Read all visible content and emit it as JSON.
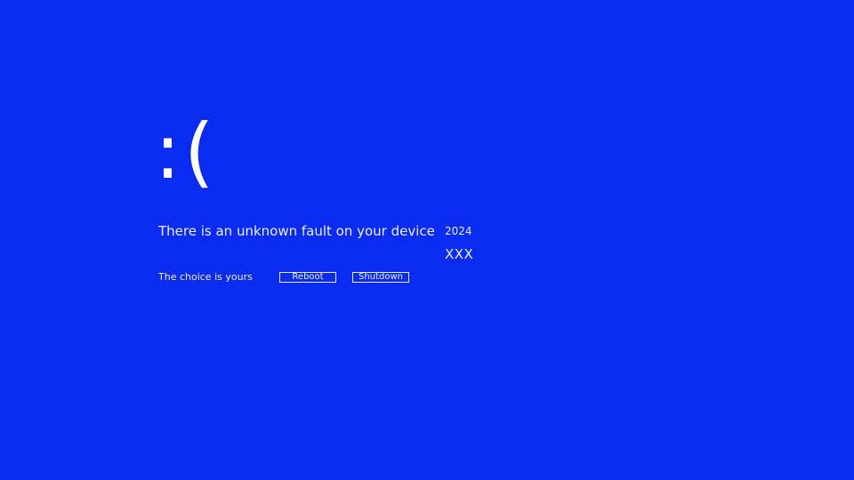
{
  "screen": {
    "background_color": "#0a2cf0",
    "text_color": "#ffffff",
    "emoticon": ":(",
    "message": "There is an unknown fault on your device",
    "year": "2024",
    "code": "XXX",
    "choice_text": "The choice is yours"
  },
  "actions": {
    "reboot_label": "Reboot",
    "shutdown_label": "Shutdown"
  }
}
